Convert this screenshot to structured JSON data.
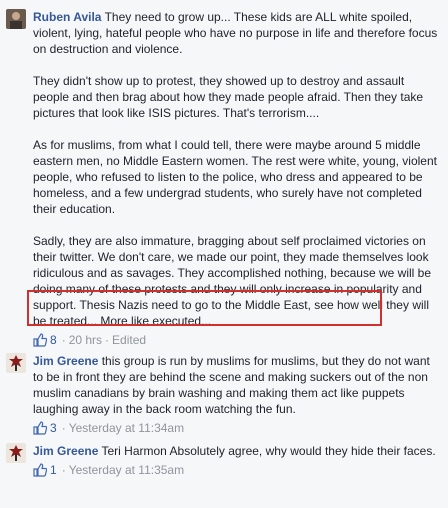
{
  "comments": [
    {
      "author": "Ruben Avila",
      "paragraphs": [
        "They need to grow up... These kids are ALL white spoiled, violent, lying, hateful people who have no purpose in life and therefore focus on destruction and violence.",
        "They didn't show up to protest, they showed up to destroy and assault people and then brag about how they made people afraid. Then they take pictures that look like ISIS pictures. That's terrorism....",
        "As for muslims, from what I could tell, there were maybe around 5 middle eastern men, no Middle Eastern women. The rest were white, young, violent people, who refused to listen to the police, who dress and appeared to be homeless, and a few undergrad students, who surely have not completed their education.",
        "Sadly, they are also immature, bragging about self proclaimed victories on their twitter. We don't care, we made our point, they made themselves look ridiculous and as savages. They accomplished nothing, because we will be doing many of these protests and they will only increase in popularity and support. Thesis Nazis need to go to the Middle East, see how well they will be treated... More like executed..."
      ],
      "likes": "8",
      "time": "20 hrs",
      "edited": "Edited"
    },
    {
      "author": "Jim Greene",
      "text": "this group is run by muslims for muslims, but they do not want to be in front they are behind the scene and making suckers out of the non muslim canadians by brain washing and making them act like puppets laughing away in the back room watching the fun.",
      "likes": "3",
      "time": "Yesterday at 11:34am"
    },
    {
      "author": "Jim Greene",
      "text": "Teri Harmon Absolutely agree, why would they hide their faces.",
      "likes": "1",
      "time": "Yesterday at 11:35am"
    }
  ],
  "colors": {
    "link": "#365899",
    "meta": "#90949c",
    "highlight": "#d0312d"
  },
  "icons": {
    "like": "thumbs-up-icon",
    "avatar": "profile-photo"
  }
}
